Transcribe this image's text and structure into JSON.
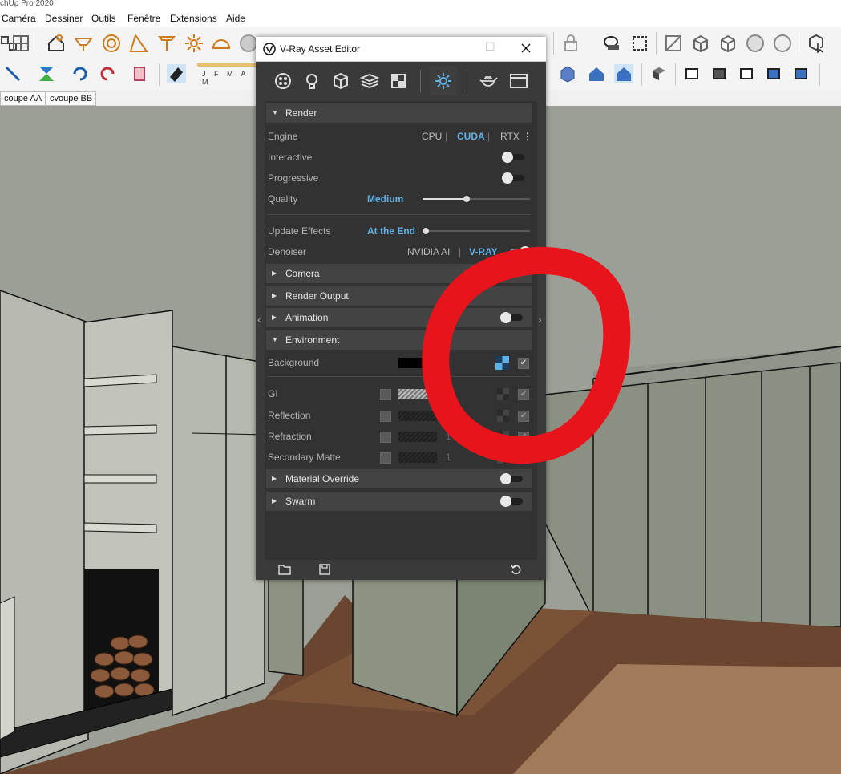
{
  "app": {
    "title": "chUp Pro 2020"
  },
  "menu": {
    "items": [
      "Caméra",
      "Dessiner",
      "Outils",
      "Fenêtre",
      "Extensions",
      "Aide"
    ]
  },
  "shadow_months": "J F M A M",
  "scenes": {
    "tabs": [
      "coupe AA",
      "cvoupe BB"
    ]
  },
  "vray": {
    "window_title": "V-Ray Asset Editor",
    "tabs": [
      "materials",
      "lights",
      "geometry",
      "render-elements",
      "textures",
      "settings",
      "render",
      "frame-buffer"
    ],
    "render": {
      "header": "Render",
      "engine_label": "Engine",
      "engines": [
        "CPU",
        "CUDA",
        "RTX"
      ],
      "engine_selected": "CUDA",
      "interactive_label": "Interactive",
      "interactive": false,
      "progressive_label": "Progressive",
      "progressive": false,
      "quality_label": "Quality",
      "quality_value": "Medium",
      "quality_level": 0.41,
      "update_effects_label": "Update Effects",
      "update_effects_value": "At the End",
      "update_effects_level": 0.0,
      "denoiser_label": "Denoiser",
      "denoiser_options": [
        "NVIDIA AI",
        "V-RAY"
      ],
      "denoiser": true
    },
    "sections": {
      "camera": "Camera",
      "render_output": "Render Output",
      "animation": "Animation",
      "environment": "Environment",
      "material_override": "Material Override",
      "swarm": "Swarm"
    },
    "environment": {
      "background_label": "Background",
      "rows": [
        {
          "label": "GI",
          "multiplier": ""
        },
        {
          "label": "Reflection",
          "multiplier": ""
        },
        {
          "label": "Refraction",
          "multiplier": "1"
        },
        {
          "label": "Secondary Matte",
          "multiplier": "1"
        }
      ]
    },
    "colors": {
      "accent": "#5fb2e8",
      "panel": "#323232",
      "header": "#434343"
    }
  },
  "annotation": {
    "color": "#e8141b"
  }
}
